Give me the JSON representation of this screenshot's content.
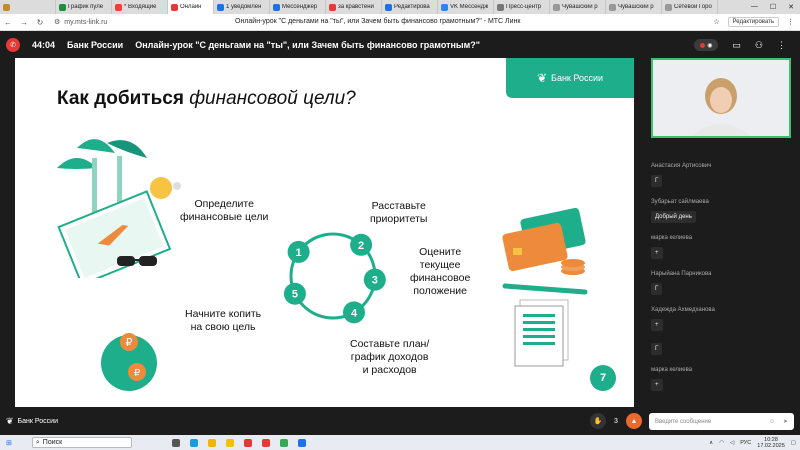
{
  "browser": {
    "tabs": [
      {
        "label": "",
        "color": "#c58b2a"
      },
      {
        "label": "График пуле",
        "color": "#1e8e3e"
      },
      {
        "label": "* Входящие",
        "color": "#ea4335"
      },
      {
        "label": "Онлайн",
        "color": "#e53935",
        "active": true
      },
      {
        "label": "1 уведомлен",
        "color": "#1a73e8"
      },
      {
        "label": "Мессенджер",
        "color": "#1a73e8"
      },
      {
        "label": "за кравстени",
        "color": "#e53935"
      },
      {
        "label": "Редактирова",
        "color": "#1a73e8"
      },
      {
        "label": "VK Мессендж",
        "color": "#2787f5"
      },
      {
        "label": "Пресс-центр",
        "color": "#777777"
      },
      {
        "label": "Чувашский р",
        "color": "#999999"
      },
      {
        "label": "Чувашский р",
        "color": "#999999"
      },
      {
        "label": "Сетевой Горо",
        "color": "#999999"
      }
    ],
    "url": "my.mts-link.ru",
    "page_title": "Онлайн-урок \"С деньгами на \"ты\", или Зачем быть финансово грамотным?\" - МТС Линк",
    "edit_label": "Редактировать"
  },
  "app": {
    "timer": "44:04",
    "org": "Банк России",
    "lesson_title": "Онлайн-урок \"С деньгами на \"ты\", или Зачем быть финансово грамотным?\"",
    "bottom_logo": "Банк России",
    "hand_count": "3",
    "chat_placeholder": "Введите сообщение"
  },
  "slide": {
    "brand": "Банк России",
    "title_bold": "Как добиться",
    "title_italic": "финансовой цели?",
    "steps": [
      {
        "n": "1",
        "text": "Определите\nфинансовые цели"
      },
      {
        "n": "2",
        "text": "Расставьте\nприоритеты"
      },
      {
        "n": "3",
        "text": "Оцените\nтекущее\nфинансовое\nположение"
      },
      {
        "n": "4",
        "text": "Составьте план/\nграфик доходов\nи расходов"
      },
      {
        "n": "5",
        "text": "Начните копить\nна свою цель"
      }
    ],
    "page_number": "7",
    "accent": "#1fae8c"
  },
  "chat": [
    {
      "name": "Анастасия Артисович",
      "message": "Г"
    },
    {
      "name": "Зубарьат сайлмаева",
      "message": "Добрый день"
    },
    {
      "name": "марка келиева",
      "message": "+"
    },
    {
      "name": "Нарыйана Парникова",
      "message": "Г"
    },
    {
      "name": "Хадежда Ахмедханова",
      "message": "+"
    },
    {
      "name": "",
      "message": "Г"
    },
    {
      "name": "марка келиева",
      "message": "+"
    }
  ],
  "taskbar": {
    "search_label": "Поиск",
    "lang": "РУС",
    "time": "10:28",
    "date": "17.02.2025"
  }
}
